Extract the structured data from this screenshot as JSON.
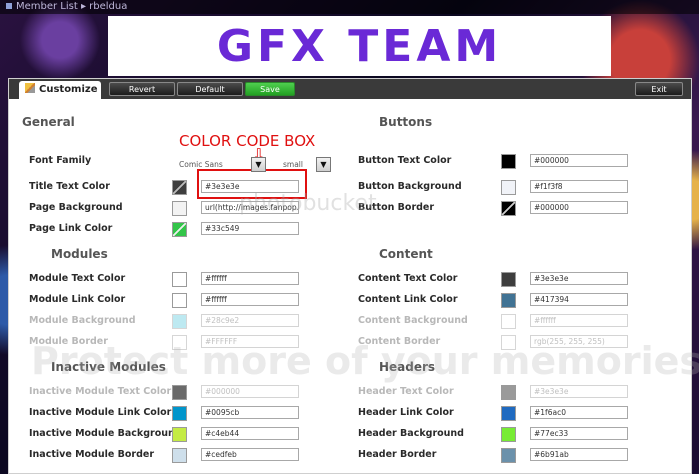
{
  "topbar": {
    "breadcrumb": "Member List ▸ rbeldua"
  },
  "banner": {
    "title": "GFX TEAM"
  },
  "toolbar": {
    "tab_label": "Customize",
    "revert_label": "Revert",
    "default_label": "Default",
    "save_label": "Save",
    "exit_label": "Exit"
  },
  "sections": {
    "general": "General",
    "buttons": "Buttons",
    "modules": "Modules",
    "content": "Content",
    "inactive_modules": "Inactive Modules",
    "headers": "Headers"
  },
  "annotation": {
    "text": "COLOR CODE BOX"
  },
  "general": {
    "font_family_label": "Font Family",
    "font_family_value": "Comic Sans",
    "font_size_value": "small",
    "title_text_label": "Title Text Color",
    "title_text_value": "#3e3e3e",
    "page_bg_label": "Page Background",
    "page_bg_value": "url(http://images.fanpop.co",
    "page_link_label": "Page Link Color",
    "page_link_value": "#33c549"
  },
  "buttons": {
    "text_label": "Button Text Color",
    "text_value": "#000000",
    "bg_label": "Button Background",
    "bg_value": "#f1f3f8",
    "border_label": "Button Border",
    "border_value": "#000000"
  },
  "modules": {
    "text_label": "Module Text Color",
    "text_value": "#ffffff",
    "link_label": "Module Link Color",
    "link_value": "#ffffff",
    "bg_label": "Module Background",
    "bg_value": "#28c9e2",
    "border_label": "Module Border",
    "border_value": "#FFFFFF"
  },
  "content": {
    "text_label": "Content Text Color",
    "text_value": "#3e3e3e",
    "link_label": "Content Link Color",
    "link_value": "#417394",
    "bg_label": "Content Background",
    "bg_value": "#ffffff",
    "border_label": "Content Border",
    "border_value": "rgb(255, 255, 255)"
  },
  "inactive": {
    "text_label": "Inactive Module Text Color",
    "text_value": "#000000",
    "link_label": "Inactive Module Link Color",
    "link_value": "#0095cb",
    "bg_label": "Inactive Module Background",
    "bg_value": "#c4eb44",
    "border_label": "Inactive Module Border",
    "border_value": "#cedfeb"
  },
  "headers": {
    "text_label": "Header Text Color",
    "text_value": "#3e3e3e",
    "link_label": "Header Link Color",
    "link_value": "#1f6ac0",
    "bg_label": "Header Background",
    "bg_value": "#77ec33",
    "border_label": "Header Border",
    "border_value": "#6b91ab"
  },
  "watermark": {
    "logo": "photobucket",
    "text": "Protect more of your memories for less!"
  },
  "colors": {
    "accent_red": "#e01010",
    "banner_purple": "#6a29d6",
    "save_green": "#33b733"
  }
}
